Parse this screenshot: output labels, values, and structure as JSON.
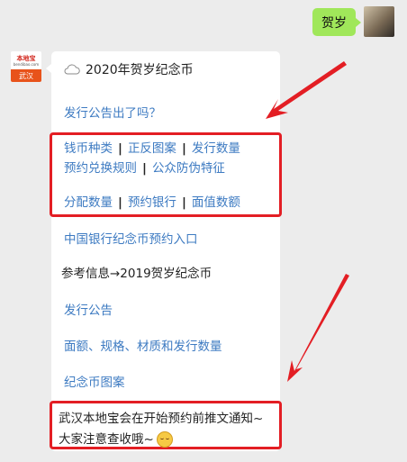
{
  "user_message": {
    "text": "贺岁"
  },
  "bot_avatar": {
    "logo": "本地宝",
    "sub": "bendibao.com",
    "city": "武汉"
  },
  "card": {
    "title": "2020年贺岁纪念币",
    "link_announce": "发行公告出了吗？",
    "box1": {
      "row1": [
        "钱币种类",
        "正反图案",
        "发行数量"
      ],
      "row2": [
        "预约兑换规则",
        "公众防伪特征"
      ],
      "row3": [
        "分配数量",
        "预约银行",
        "面值数额"
      ],
      "separator": "|"
    },
    "link_reserve": "中国银行纪念币预约入口",
    "ref_info": "参考信息→2019贺岁纪念币",
    "link_publish": "发行公告",
    "link_specs": "面额、规格、材质和发行数量",
    "link_design": "纪念币图案",
    "notice": {
      "line1": "武汉本地宝会在开始预约前推文通知~",
      "line2": "大家注意查收哦~"
    }
  },
  "colors": {
    "link": "#3e7bc2",
    "highlight": "#e31e24",
    "bubble": "#a0e75a"
  }
}
